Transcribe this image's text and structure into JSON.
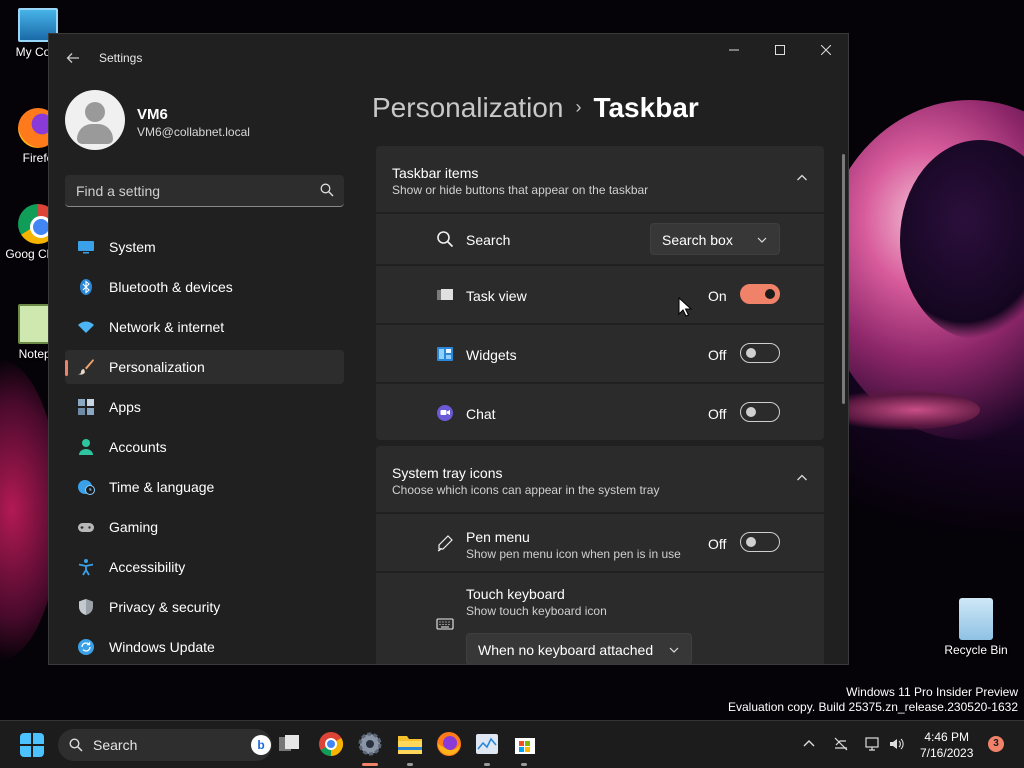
{
  "desktop": {
    "icons": [
      {
        "label": "My Com"
      },
      {
        "label": "Firefo"
      },
      {
        "label": "Goog Chron"
      },
      {
        "label": "Notepa"
      },
      {
        "label": "Recycle Bin"
      }
    ],
    "watermark_line1": "Windows 11 Pro Insider Preview",
    "watermark_line2": "Evaluation copy. Build 25375.zn_release.230520-1632"
  },
  "window": {
    "app_title": "Settings",
    "minimize_icon": "minimize-icon",
    "maximize_icon": "maximize-icon",
    "close_icon": "close-icon"
  },
  "user": {
    "name": "VM6",
    "email": "VM6@collabnet.local"
  },
  "search": {
    "placeholder": "Find a setting",
    "value": ""
  },
  "sidebar": {
    "items": [
      {
        "label": "System",
        "icon": "monitor-icon",
        "color": "#3aa0e8"
      },
      {
        "label": "Bluetooth & devices",
        "icon": "bluetooth-icon",
        "color": "#2b88d8"
      },
      {
        "label": "Network & internet",
        "icon": "wifi-icon",
        "color": "#4cb4f5"
      },
      {
        "label": "Personalization",
        "icon": "brush-icon",
        "color": "#f2a46b",
        "active": true
      },
      {
        "label": "Apps",
        "icon": "apps-icon",
        "color": "#8aa8c4"
      },
      {
        "label": "Accounts",
        "icon": "person-icon",
        "color": "#2fc4a0"
      },
      {
        "label": "Time & language",
        "icon": "globe-clock-icon",
        "color": "#3aa0e8"
      },
      {
        "label": "Gaming",
        "icon": "gamepad-icon",
        "color": "#b8b8b8"
      },
      {
        "label": "Accessibility",
        "icon": "accessibility-icon",
        "color": "#3aa0e8"
      },
      {
        "label": "Privacy & security",
        "icon": "shield-icon",
        "color": "#9aa0a8"
      },
      {
        "label": "Windows Update",
        "icon": "update-icon",
        "color": "#3aa0e8"
      }
    ]
  },
  "breadcrumb": {
    "parent": "Personalization",
    "separator": "›",
    "current": "Taskbar"
  },
  "sections": {
    "taskbar_items": {
      "title": "Taskbar items",
      "description": "Show or hide buttons that appear on the taskbar",
      "rows": {
        "search": {
          "label": "Search",
          "value": "Search box"
        },
        "task_view": {
          "label": "Task view",
          "state": "On"
        },
        "widgets": {
          "label": "Widgets",
          "state": "Off"
        },
        "chat": {
          "label": "Chat",
          "state": "Off"
        }
      }
    },
    "system_tray": {
      "title": "System tray icons",
      "description": "Choose which icons can appear in the system tray",
      "rows": {
        "pen_menu": {
          "label": "Pen menu",
          "description": "Show pen menu icon when pen is in use",
          "state": "Off"
        },
        "touch_keyboard": {
          "label": "Touch keyboard",
          "description": "Show touch keyboard icon",
          "value": "When no keyboard attached"
        }
      }
    }
  },
  "taskbar": {
    "search_label": "Search",
    "bing_label": "b",
    "clock_time": "4:46 PM",
    "clock_date": "7/16/2023",
    "notification_count": "3",
    "accent": "#f0826a"
  }
}
